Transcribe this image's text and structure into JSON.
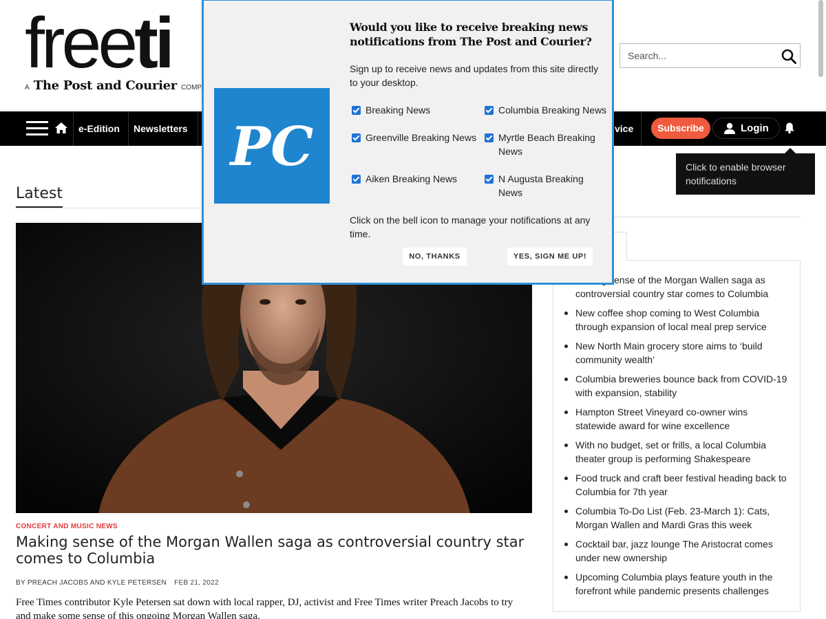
{
  "header": {
    "logo_word_light": "free",
    "logo_word_bold": "ti",
    "logo_sub_prefix": "A",
    "logo_sub_brand": "The Post and Courier",
    "logo_sub_suffix": "COMPANY",
    "search_placeholder": "Search..."
  },
  "nav": {
    "items": [
      "e-Edition",
      "Newsletters",
      "vice"
    ],
    "subscribe_label": "Subscribe",
    "login_label": "Login",
    "tooltip": "Click to enable browser notifications"
  },
  "popup": {
    "logo_text": "PC",
    "title": "Would you like to receive breaking news notifications from The Post and Courier?",
    "body": "Sign up to receive news and updates from this site directly to your desktop.",
    "options": [
      {
        "label": "Breaking News",
        "checked": true
      },
      {
        "label": "Columbia Breaking News",
        "checked": true
      },
      {
        "label": "Greenville Breaking News",
        "checked": true
      },
      {
        "label": "Myrtle Beach Breaking News",
        "checked": true
      },
      {
        "label": "Aiken Breaking News",
        "checked": true
      },
      {
        "label": "N Augusta Breaking News",
        "checked": true
      }
    ],
    "footer": "Click on the bell icon to manage your notifications at any time.",
    "decline_label": "NO, THANKS",
    "accept_label": "YES, SIGN ME UP!"
  },
  "main": {
    "section_title": "Latest",
    "kicker": "CONCERT AND MUSIC NEWS",
    "headline": "Making sense of the Morgan Wallen saga as controversial country star comes to Columbia",
    "byline": "BY PREACH JACOBS AND KYLE PETERSEN",
    "date": "FEB 21, 2022",
    "summary": "Free Times contributor Kyle Petersen sat down with local rapper, DJ, activist and Free Times writer Preach Jacobs to try and make some sense of this ongoing Morgan Wallen saga."
  },
  "sidebar": {
    "tab_label_fragment": "s",
    "headlines": [
      "Making sense of the Morgan Wallen saga as controversial country star comes to Columbia",
      "New coffee shop coming to West Columbia through expansion of local meal prep service",
      "New North Main grocery store aims to ‘build community wealth’",
      "Columbia breweries bounce back from COVID-19 with expansion, stability",
      "Hampton Street Vineyard co-owner wins statewide award for wine excellence",
      "With no budget, set or frills, a local Columbia theater group is performing Shakespeare",
      "Food truck and craft beer festival heading back to Columbia for 7th year",
      "Columbia To-Do List (Feb. 23-March 1): Cats, Morgan Wallen and Mardi Gras this week",
      "Cocktail bar, jazz lounge The Aristocrat comes under new ownership",
      "Upcoming Columbia plays feature youth in the forefront while pandemic presents challenges"
    ]
  },
  "colors": {
    "accent_subscribe": "#f05b3f",
    "popup_border": "#2f8fd6",
    "pc_logo_bg": "#1f85cf",
    "kicker": "#e03a3a",
    "checkbox": "#1f72d6"
  }
}
